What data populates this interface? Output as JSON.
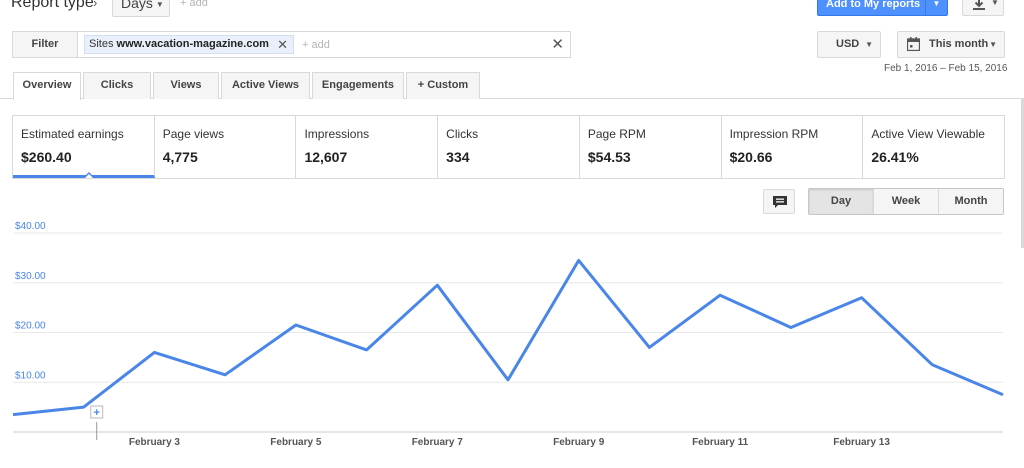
{
  "header": {
    "report_type_label": "Report type",
    "chevron": "›",
    "days_label": "Days",
    "add_label": "+ add",
    "add_reports_label": "Add to My reports",
    "caret": "▼"
  },
  "filter": {
    "button_label": "Filter",
    "chip_prefix": "Sites",
    "chip_value": "www.vacation-magazine.com",
    "chip_remove": "✕",
    "add_label": "+ add",
    "clear": "✕"
  },
  "currency": {
    "label": "USD"
  },
  "date": {
    "label": "This month",
    "range": "Feb 1, 2016 – Feb 15, 2016"
  },
  "tabs": [
    {
      "label": "Overview",
      "active": true
    },
    {
      "label": "Clicks"
    },
    {
      "label": "Views"
    },
    {
      "label": "Active Views"
    },
    {
      "label": "Engagements"
    },
    {
      "label": "+  Custom"
    }
  ],
  "metrics": [
    {
      "label": "Estimated earnings",
      "value": "$260.40",
      "active": true
    },
    {
      "label": "Page views",
      "value": "4,775"
    },
    {
      "label": "Impressions",
      "value": "12,607"
    },
    {
      "label": "Clicks",
      "value": "334"
    },
    {
      "label": "Page RPM",
      "value": "$54.53"
    },
    {
      "label": "Impression RPM",
      "value": "$20.66"
    },
    {
      "label": "Active View Viewable",
      "value": "26.41%"
    }
  ],
  "granularity": [
    {
      "label": "Day",
      "active": true
    },
    {
      "label": "Week"
    },
    {
      "label": "Month"
    }
  ],
  "colors": {
    "accent": "#4a86e8",
    "axis_label": "#4a86e8",
    "grid": "#e8e8e8"
  },
  "chart_data": {
    "type": "line",
    "title": "",
    "xlabel": "",
    "ylabel": "",
    "ylim": [
      0,
      40
    ],
    "yticks": [
      "$10.00",
      "$20.00",
      "$30.00",
      "$40.00"
    ],
    "ytick_values": [
      10,
      20,
      30,
      40
    ],
    "xticks": [
      "February 3",
      "February 5",
      "February 7",
      "February 9",
      "February 11",
      "February 13"
    ],
    "xtick_index": [
      2,
      4,
      6,
      8,
      10,
      12
    ],
    "x": [
      "Feb 1",
      "Feb 2",
      "Feb 3",
      "Feb 4",
      "Feb 5",
      "Feb 6",
      "Feb 7",
      "Feb 8",
      "Feb 9",
      "Feb 10",
      "Feb 11",
      "Feb 12",
      "Feb 13",
      "Feb 14",
      "Feb 15"
    ],
    "series": [
      {
        "values": [
          3.5,
          5.0,
          16.0,
          11.5,
          21.5,
          16.5,
          29.5,
          10.5,
          34.5,
          17.0,
          27.5,
          21.0,
          27.0,
          13.5,
          7.5
        ]
      }
    ],
    "grid": true,
    "annotation_marker": "+"
  }
}
